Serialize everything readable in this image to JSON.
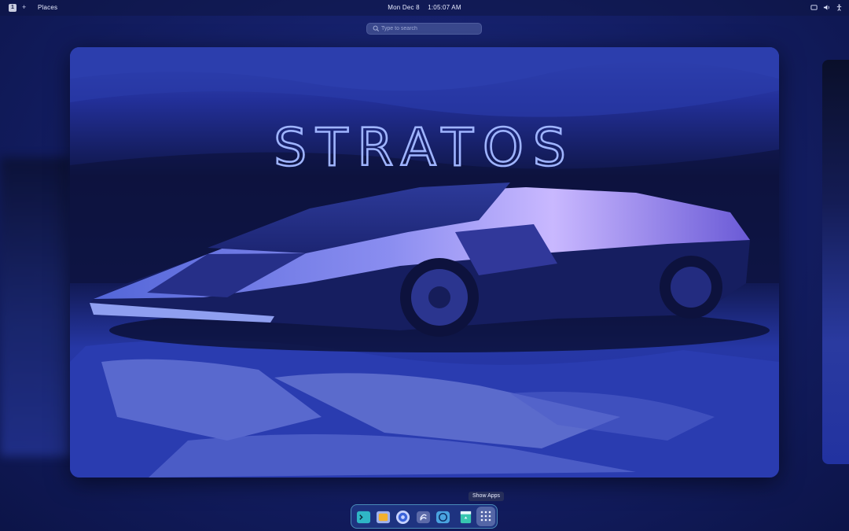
{
  "topbar": {
    "workspace_number": "1",
    "add_workspace_label": "+",
    "places_label": "Places",
    "date": "Mon Dec 8",
    "time": "1:05:07 AM",
    "tray_icons": [
      "screen-icon",
      "volume-icon",
      "accessibility-icon"
    ]
  },
  "search": {
    "placeholder": "Type to search"
  },
  "preview": {
    "wallpaper_title": "STRATOS"
  },
  "tooltip": {
    "text": "Show Apps"
  },
  "dock": {
    "items": [
      {
        "name": "terminal-icon"
      },
      {
        "name": "files-icon"
      },
      {
        "name": "settings-icon"
      },
      {
        "name": "software-icon"
      },
      {
        "name": "browser-icon"
      },
      {
        "name": "recycle-icon"
      }
    ],
    "show_apps_icon": "grid-icon"
  },
  "colors": {
    "accent": "#6fd3e6",
    "wallpaper_deep": "#161f6e",
    "wallpaper_light": "#8fa2ee"
  }
}
